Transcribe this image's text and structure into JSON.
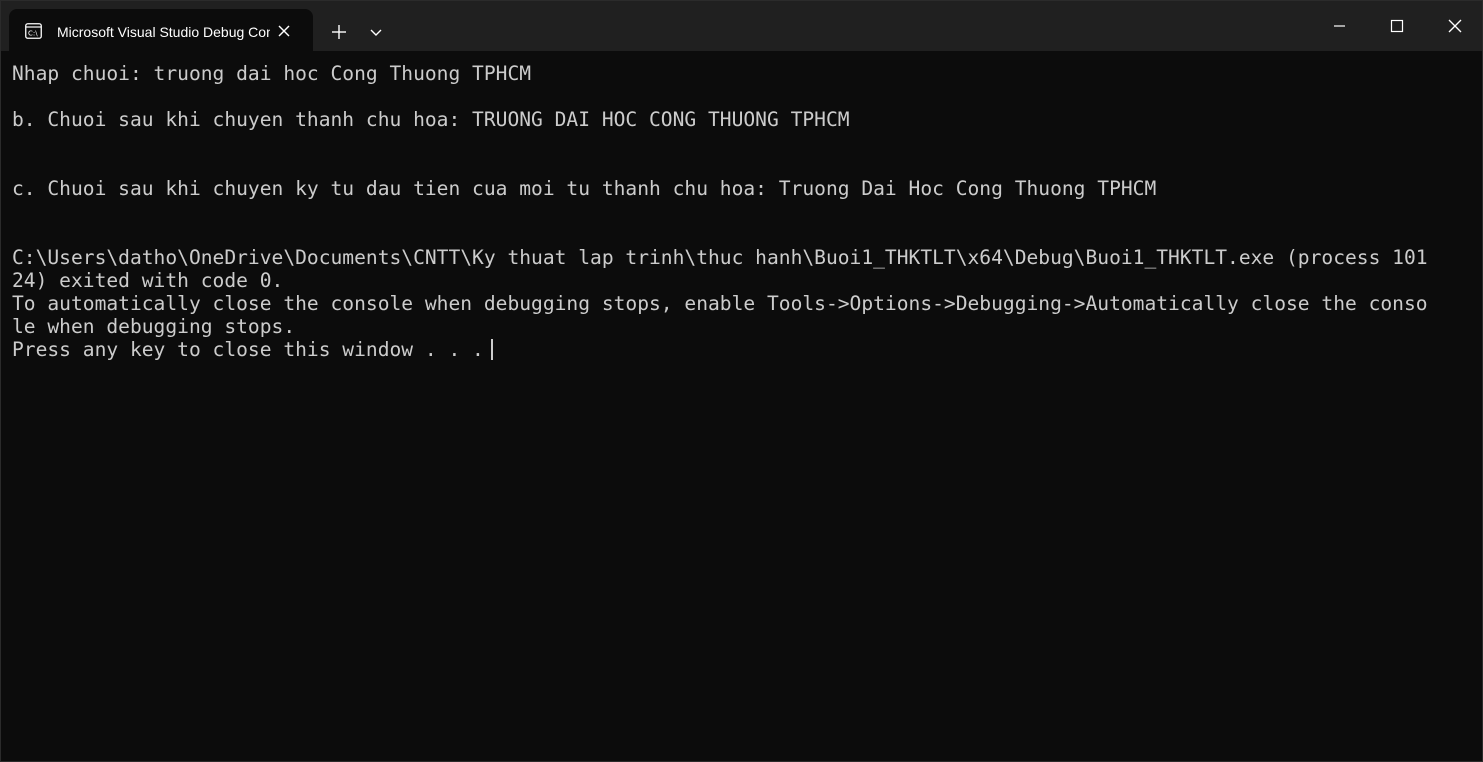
{
  "window": {
    "tab_title": "Microsoft Visual Studio Debug Console"
  },
  "icons": {
    "tab_icon": "console-app-icon",
    "tab_close": "close-icon",
    "new_tab": "plus-icon",
    "dropdown": "chevron-down-icon",
    "minimize": "minimize-icon",
    "maximize": "maximize-icon",
    "close": "close-icon"
  },
  "colors": {
    "background": "#0c0c0c",
    "titlebar": "#202020",
    "text": "#cccccc"
  },
  "console": {
    "lines": [
      "Nhap chuoi: truong dai hoc Cong Thuong TPHCM",
      "b. Chuoi sau khi chuyen thanh chu hoa: TRUONG DAI HOC CONG THUONG TPHCM",
      "c. Chuoi sau khi chuyen ky tu dau tien cua moi tu thanh chu hoa: Truong Dai Hoc Cong Thuong TPHCM",
      "C:\\Users\\datho\\OneDrive\\Documents\\CNTT\\Ky thuat lap trinh\\thuc hanh\\Buoi1_THKTLT\\x64\\Debug\\Buoi1_THKTLT.exe (process 101",
      "24) exited with code 0.",
      "To automatically close the console when debugging stops, enable Tools->Options->Debugging->Automatically close the conso",
      "le when debugging stops.",
      "Press any key to close this window . . ."
    ]
  }
}
